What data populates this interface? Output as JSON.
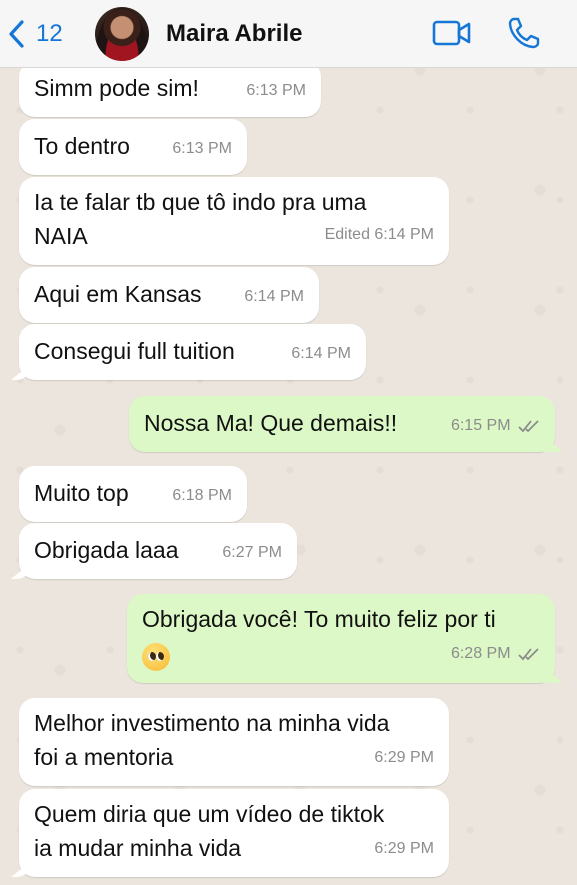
{
  "header": {
    "back_count": "12",
    "contact_name": "Maira Abrile"
  },
  "colors": {
    "accent": "#1476d6",
    "incoming_bubble": "#ffffff",
    "outgoing_bubble": "#dcf8c6",
    "timestamp": "#8c8c8c"
  },
  "messages": [
    {
      "dir": "in",
      "text": "Simm pode sim!",
      "time": "6:13 PM"
    },
    {
      "dir": "in",
      "text": "To dentro",
      "time": "6:13 PM"
    },
    {
      "dir": "in",
      "text_line1": "Ia te falar tb que tô indo pra uma",
      "text_line2": "NAIA",
      "time": "Edited 6:14 PM"
    },
    {
      "dir": "in",
      "text": "Aqui em Kansas",
      "time": "6:14 PM"
    },
    {
      "dir": "in",
      "text": "Consegui full tuition",
      "time": "6:14 PM"
    },
    {
      "dir": "out",
      "text": "Nossa Ma! Que demais!!",
      "time": "6:15 PM",
      "status": "read"
    },
    {
      "dir": "in",
      "text": "Muito top",
      "time": "6:18 PM"
    },
    {
      "dir": "in",
      "text": "Obrigada laaa",
      "time": "6:27 PM"
    },
    {
      "dir": "out",
      "text": "Obrigada você! To muito feliz por ti",
      "emoji": "pleading-face-emoji",
      "time": "6:28 PM",
      "status": "read"
    },
    {
      "dir": "in",
      "text_line1": "Melhor investimento na minha vida",
      "text_line2": "foi a mentoria",
      "time": "6:29 PM"
    },
    {
      "dir": "in",
      "text_line1": "Quem diria que um vídeo de tiktok",
      "text_line2": "ia mudar minha vida",
      "time": "6:29 PM"
    }
  ]
}
